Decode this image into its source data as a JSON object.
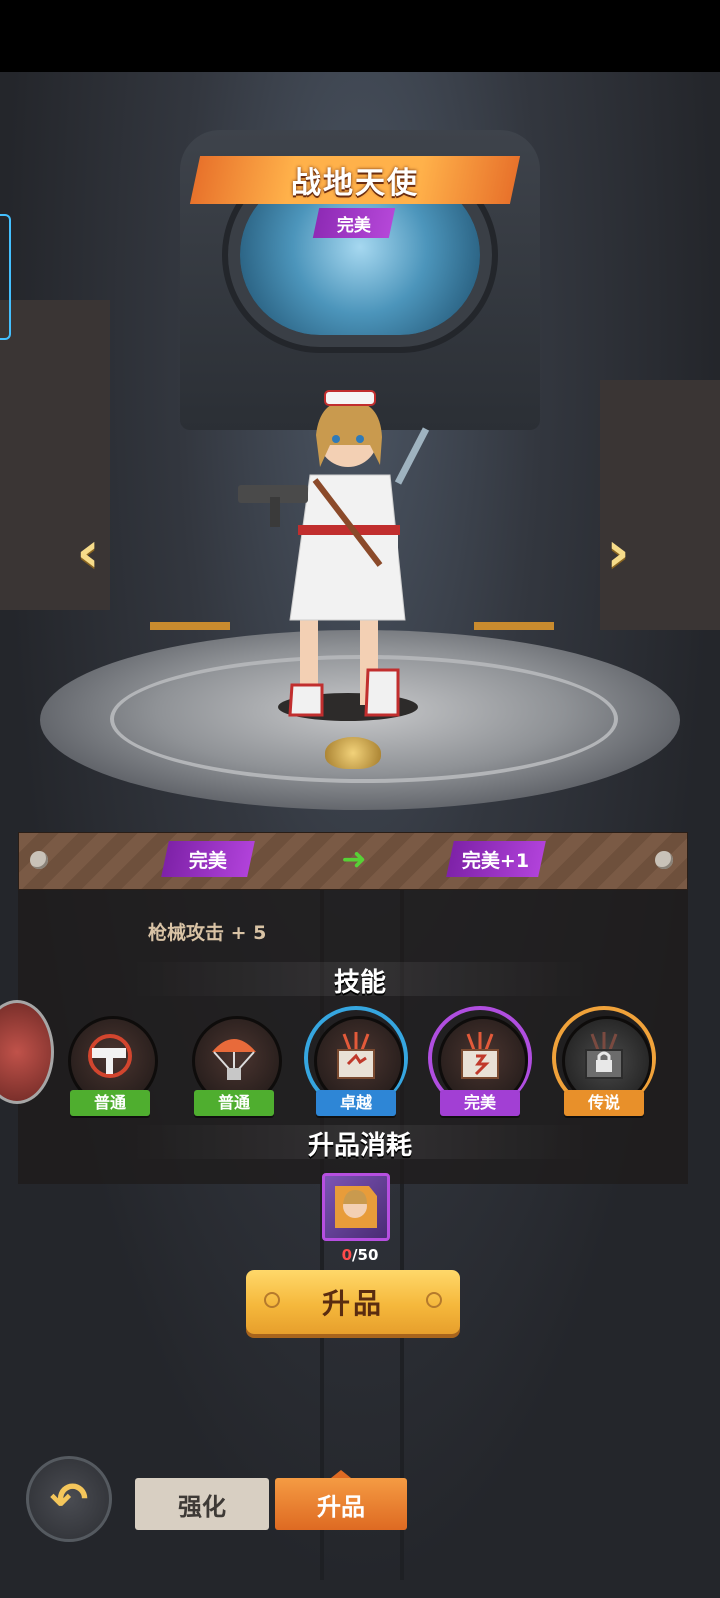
{
  "hero": {
    "name": "战地天使",
    "rank": "完美"
  },
  "upgrade": {
    "from_rank": "完美",
    "to_rank": "完美+1",
    "stat_bonus": "枪械攻击 + 5"
  },
  "skills": {
    "title": "技能",
    "items": [
      {
        "icon": "uzi-gun-icon",
        "tier": "普通",
        "tier_color": "#4fae2f"
      },
      {
        "icon": "airdrop-parachute-icon",
        "tier": "普通",
        "tier_color": "#4fae2f"
      },
      {
        "icon": "supply-crate-icon",
        "tier": "卓越",
        "tier_color": "#2e86d6"
      },
      {
        "icon": "supply-crate-icon",
        "tier": "完美",
        "tier_color": "#a23fd4"
      },
      {
        "icon": "locked-crate-icon",
        "tier": "传说",
        "tier_color": "#e8902a"
      }
    ]
  },
  "cost": {
    "title": "升品消耗",
    "item_icon": "hero-shard-icon",
    "have": "0",
    "need": "/50"
  },
  "actions": {
    "upgrade_button": "升品"
  },
  "bottom_tabs": {
    "enhance": "强化",
    "upgrade": "升品"
  }
}
